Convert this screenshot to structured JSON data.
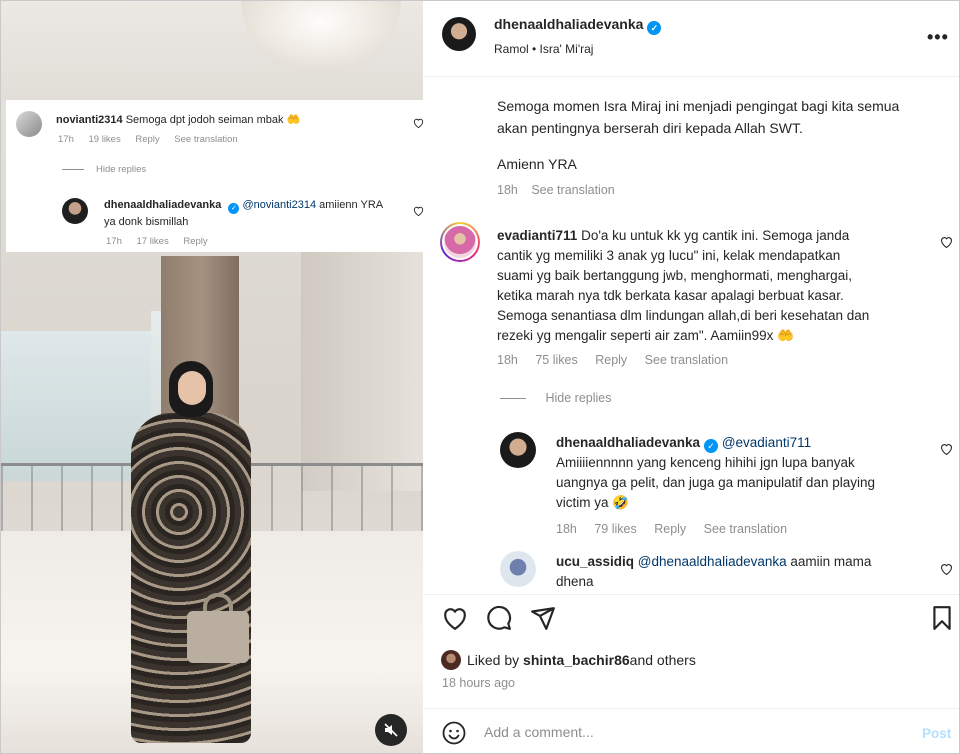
{
  "overlay": {
    "comment1": {
      "user": "novianti2314",
      "text": "Semoga dpt jodoh seiman mbak",
      "emoji": "🤲",
      "time": "17h",
      "likes": "19 likes",
      "reply": "Reply",
      "translate": "See translation"
    },
    "hide_replies": "Hide replies",
    "reply1": {
      "user": "dhenaaldhaliadevanka",
      "mention": "@novianti2314",
      "text_line1": " amiienn YRA",
      "text_line2": "ya donk bismillah",
      "time": "17h",
      "likes": "17 likes",
      "reply": "Reply"
    }
  },
  "header": {
    "username": "dhenaaldhaliadevanka",
    "location": "Ramol • Isra' Mi'raj",
    "more": "•••"
  },
  "caption": {
    "line1": "Semoga momen Isra Miraj ini menjadi pengingat bagi kita semua",
    "line2": "akan pentingnya berserah diri kepada Allah SWT.",
    "line3": "Amienn YRA",
    "time": "18h",
    "translate": "See translation"
  },
  "comments": {
    "eva": {
      "user": "evadianti711",
      "line1": " Do'a ku untuk kk yg cantik ini. Semoga janda",
      "line2": "cantik yg memiliki 3 anak yg lucu\" ini, kelak mendapatkan",
      "line3": "suami yg baik bertanggung jwb, menghormati, menghargai,",
      "line4": "ketika marah nya tdk berkata kasar apalagi berbuat kasar.",
      "line5": "Semoga senantiasa dlm lindungan allah,di beri kesehatan dan",
      "line6": "rezeki yg mengalir seperti air zam\". Aamiin99x",
      "emoji": "🤲",
      "time": "18h",
      "likes": "75 likes",
      "reply": "Reply",
      "translate": "See translation"
    },
    "hide_replies": "Hide replies",
    "dhena_reply": {
      "user": "dhenaaldhaliadevanka",
      "mention": "@evadianti711",
      "line1": "Amiiiiennnnn yang kenceng hihihi jgn lupa banyak",
      "line2": "uangnya ga pelit, dan juga ga manipulatif dan playing",
      "line3": "victim ya",
      "emoji": "🤣",
      "time": "18h",
      "likes": "79 likes",
      "reply": "Reply",
      "translate": "See translation"
    },
    "ucu": {
      "user": "ucu_assidiq",
      "mention": "@dhenaaldhaliadevanka",
      "line1": " aamiin mama",
      "line2": "dhena"
    }
  },
  "liked_by": {
    "prefix": "Liked by ",
    "user": "shinta_bachir86",
    "suffix": " and others"
  },
  "time_ago": "18 hours ago",
  "comment_bar": {
    "placeholder": "Add a comment...",
    "post": "Post"
  },
  "icons": [
    "emoji-icon",
    "heart-icon",
    "comment-icon",
    "share-icon",
    "bookmark-icon",
    "mute-icon",
    "verified-icon",
    "more-icon"
  ],
  "colors": {
    "link": "#00376b",
    "verified": "#0095f6",
    "muted": "#8e8e8e",
    "post_disabled": "#b2dffc"
  }
}
